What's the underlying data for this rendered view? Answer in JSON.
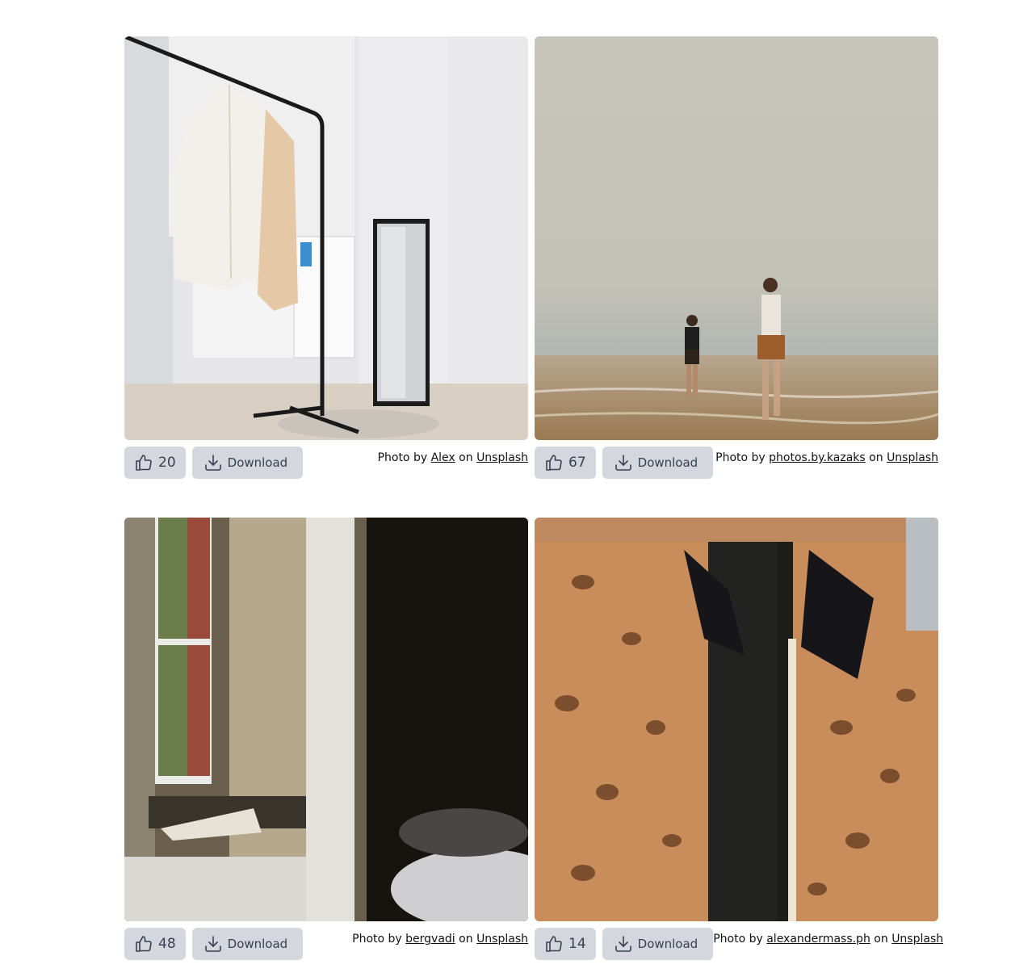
{
  "cards": [
    {
      "likes": "20",
      "download_label": "Download",
      "credit_prefix": "Photo by",
      "author": "Alex",
      "credit_mid": "on",
      "source": "Unsplash"
    },
    {
      "likes": "67",
      "download_label": "Download",
      "credit_prefix": "Photo by",
      "author": "photos.by.kazaks",
      "credit_mid": "on",
      "source": "Unsplash"
    },
    {
      "likes": "48",
      "download_label": "Download",
      "credit_prefix": "Photo by",
      "author": "bergvadi",
      "credit_mid": "on",
      "source": "Unsplash"
    },
    {
      "likes": "14",
      "download_label": "Download",
      "credit_prefix": "Photo by",
      "author": "alexandermass.ph",
      "credit_mid": "on",
      "source": "Unsplash"
    }
  ],
  "icons": {
    "like": "thumbs-up-icon",
    "download": "download-icon"
  },
  "colors": {
    "button_bg": "#d4d7de",
    "button_text": "#374151",
    "link_text": "#111111"
  }
}
